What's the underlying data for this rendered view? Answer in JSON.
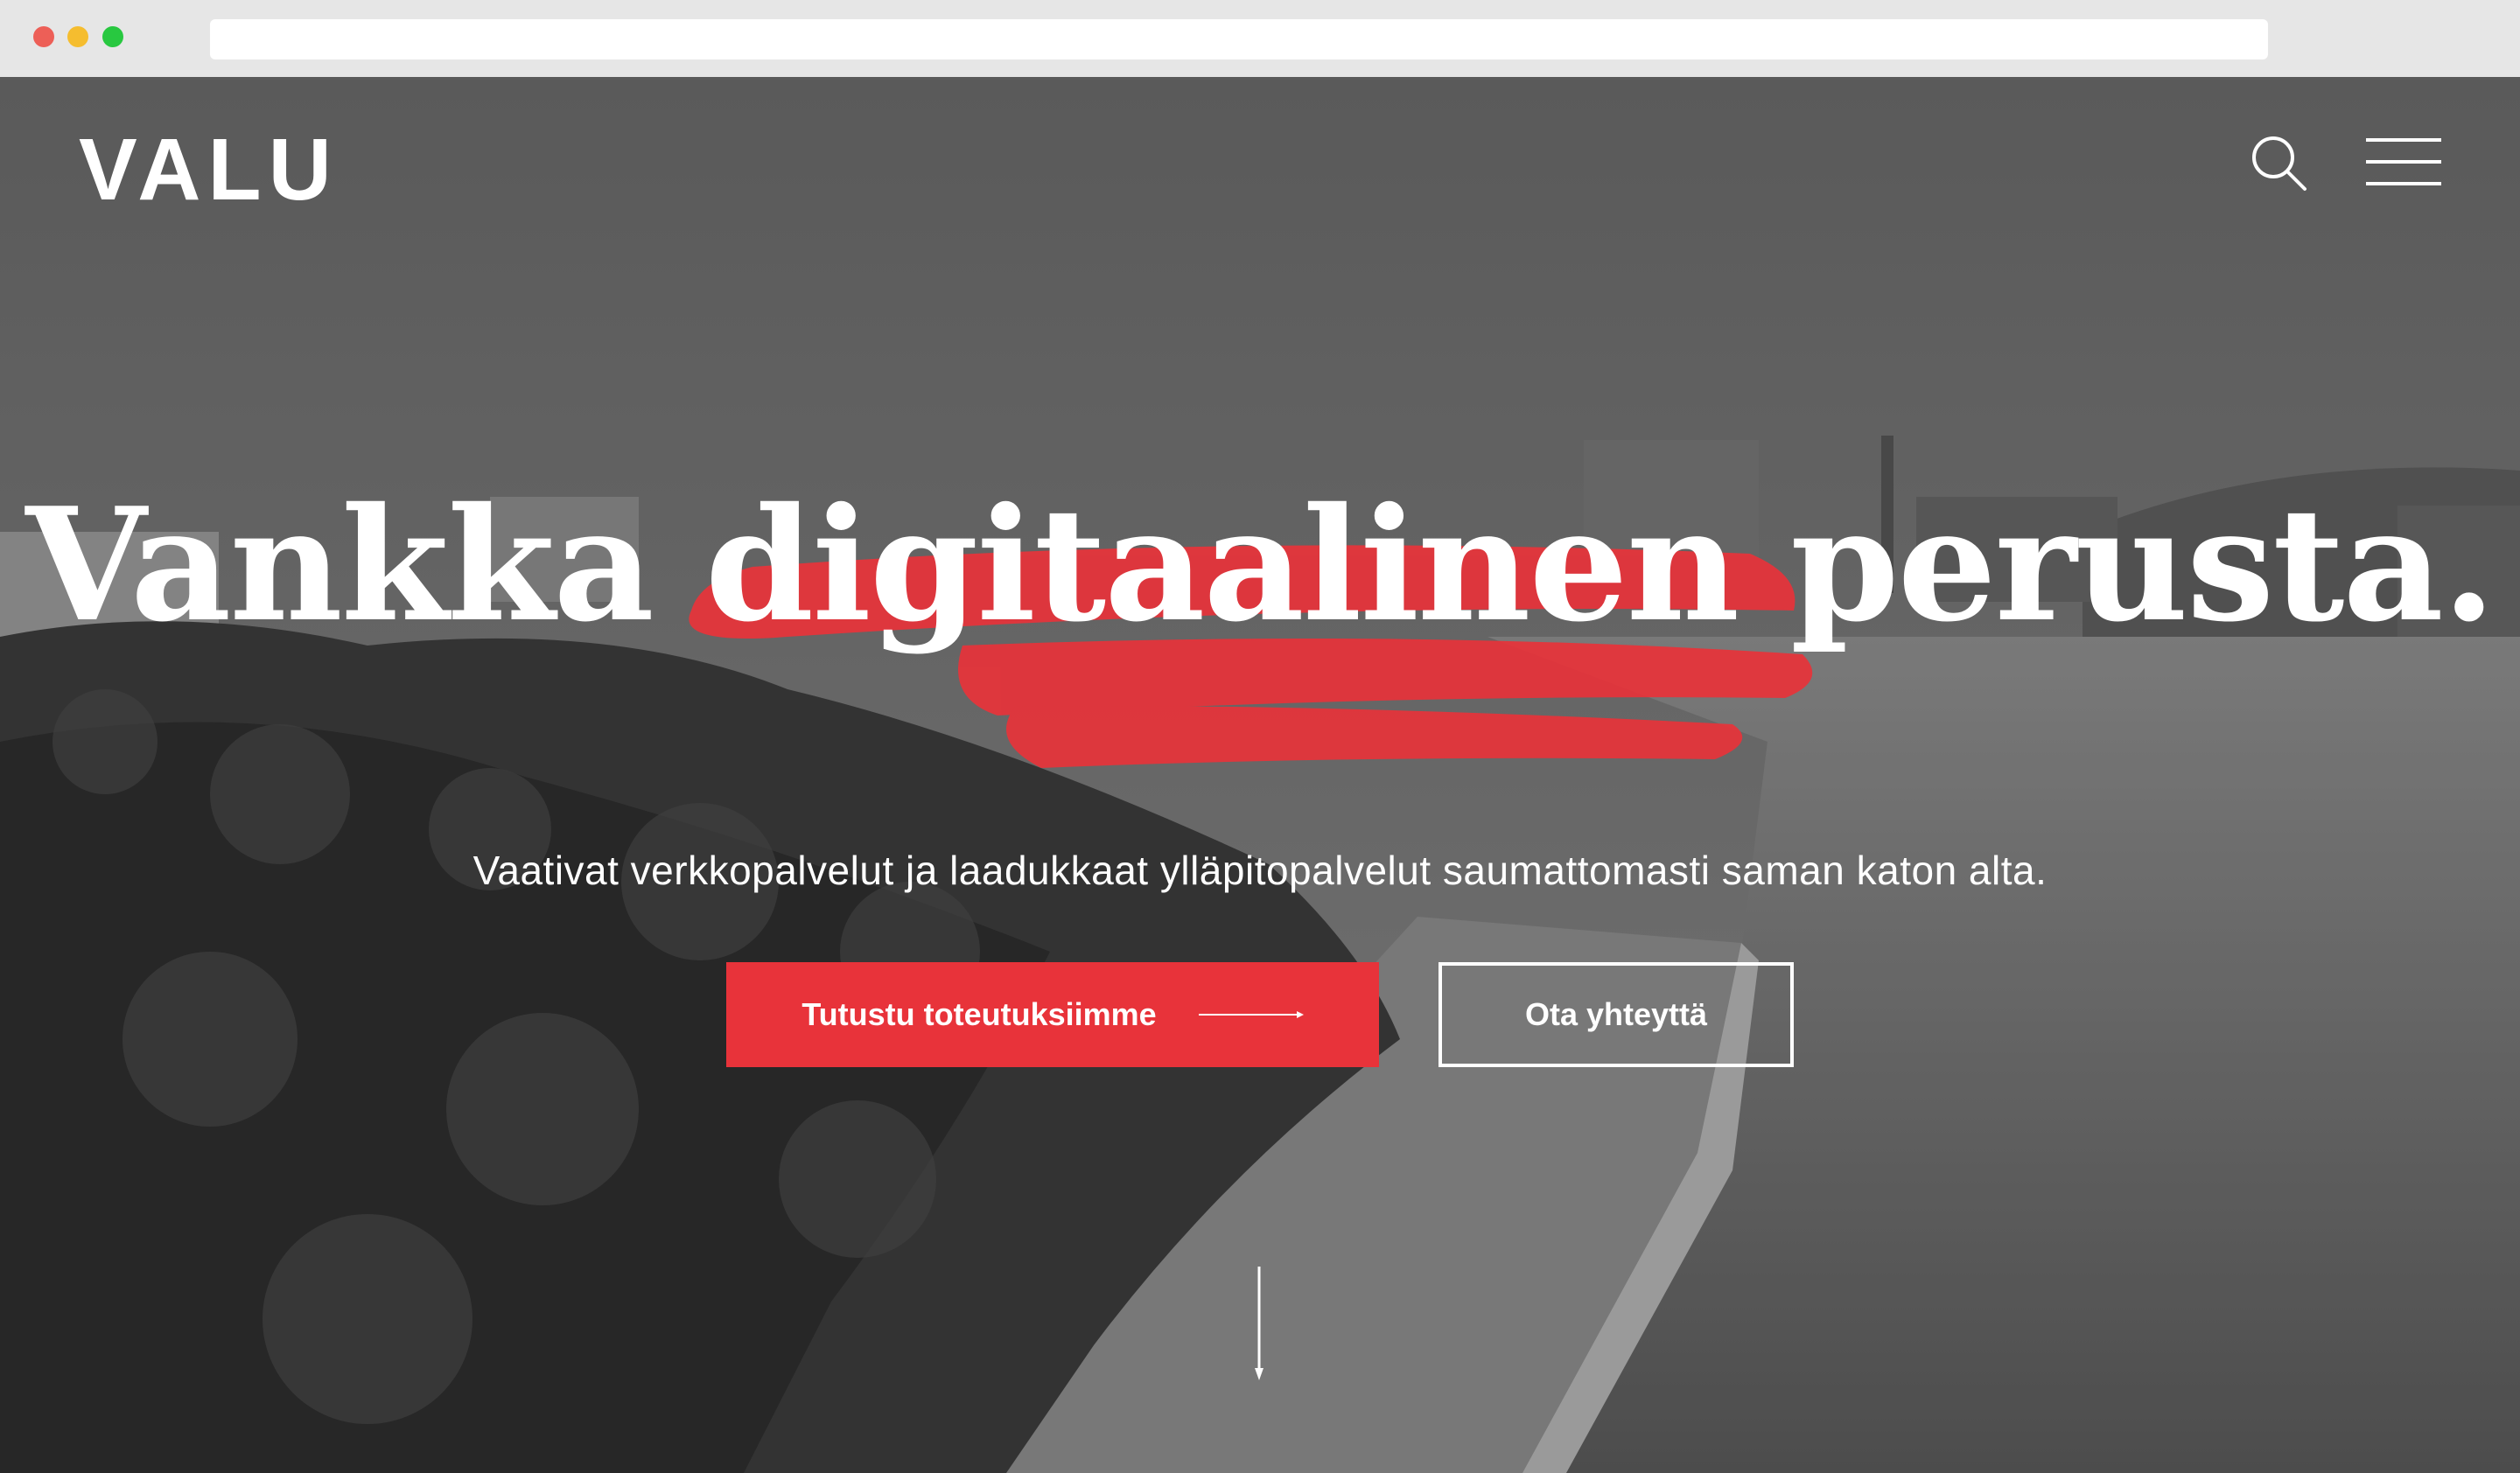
{
  "site": {
    "logo_text": "VALU"
  },
  "header": {
    "search_icon": "search-icon",
    "menu_icon": "hamburger-menu-icon"
  },
  "hero": {
    "headline": "Vankka digitaalinen perusta.",
    "subheadline": "Vaativat verkkopalvelut ja laadukkaat ylläpitopalvelut saumattomasti saman katon alta.",
    "primary_button_label": "Tutustu toteutuksiimme",
    "secondary_button_label": "Ota yhteyttä",
    "scroll_icon": "arrow-down-icon"
  },
  "colors": {
    "accent": "#e8333a",
    "text": "#ffffff",
    "overlay": "#6d6d6d"
  }
}
